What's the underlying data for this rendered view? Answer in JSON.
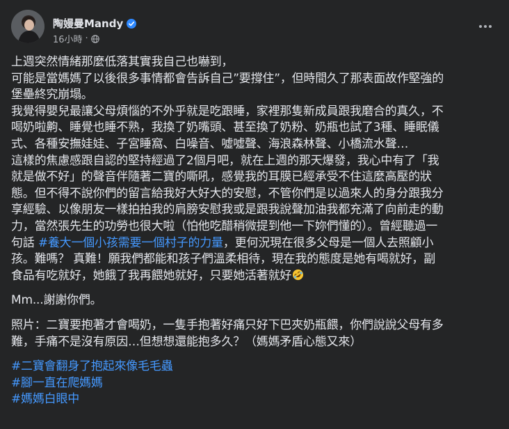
{
  "author": {
    "name": "陶嫚曼Mandy",
    "time": "16小時",
    "separator": "·",
    "verified_icon": "verified-badge-icon",
    "privacy_icon": "globe-icon",
    "menu_icon": "more-options-icon"
  },
  "post": {
    "p1": [
      "上週突然情緒那麼低落其實我自己也嚇到，",
      "可能是當媽媽了以後很多事情都會告訴自己”要撐住”，但時間久了那表面故作堅強的",
      "堡壘終究崩塌。",
      "我覺得嬰兒最讓父母煩惱的不外乎就是吃跟睡，家裡那隻新成員跟我磨合的真久，不",
      "喝奶啦齁、睡覺也睡不熟，我換了奶嘴頭、甚至換了奶粉、奶瓶也試了3種、睡眠儀",
      "式、各種安撫娃娃、子宮睡窩、白噪音、噓噓聲、海浪森林聲、小橋流水聲…",
      "這樣的焦慮感跟自認的堅持經過了2個月吧，就在上週的那天爆發，我心中有了「我",
      "就是做不好」的聲音伴隨著二寶的嘶吼，感覺我的耳膜已經承受不住這麼高壓的狀",
      "態。但不得不說你們的留言給我好大好大的安慰，不管你們是以過來人的身分跟我分",
      "享經驗、以像朋友一樣拍拍我的肩膀安慰我或是跟我說聲加油我都充滿了向前走的動",
      "力，當然張先生的功勞也很大啦（怕他吃醋稍微提到他一下妳們懂的）。曾經聽過一"
    ],
    "p1_line12_before": "句話 ",
    "p1_line12_hashtag": "#養大一個小孩需要一個村子的力量",
    "p1_line12_after": "，更何況現在很多父母是一個人去照顧小",
    "p1_tail": [
      "孩。難嗎？ 真難！願我們都能和孩子們溫柔相待，現在我的態度是她有喝就好，副",
      "食品有吃就好，她餓了我再餵她就好，只要她活著就好"
    ],
    "emoji_icon": "rolling-on-floor-laughing-emoji",
    "p2": "Mm...謝謝你們。",
    "p3": [
      "照片：二寶要抱著才會喝奶，一隻手抱著好痛只好下巴夾奶瓶餵，你們說說父母有多",
      "難，手痛不是沒有原因…但想想還能抱多久？（媽媽矛盾心態又來）"
    ],
    "hashtags": [
      "#二寶會翻身了抱起來像毛毛蟲",
      "#腳一直在爬媽媽",
      "#媽媽白眼中"
    ]
  },
  "colors": {
    "background": "#242526",
    "text": "#e4e6eb",
    "secondary": "#b0b3b8",
    "link": "#4599ff",
    "verified": "#2d88ff"
  }
}
